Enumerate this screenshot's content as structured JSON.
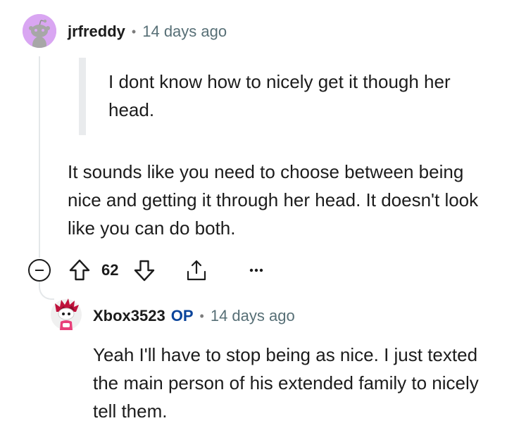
{
  "comment": {
    "author": "jrfreddy",
    "separator": "•",
    "time": "14 days ago",
    "quote": "I dont know how to nicely get it though her head.",
    "body": "It sounds like you need to choose between being nice and getting it through her head. It doesn't look like you can do both.",
    "vote_count": "62",
    "more_label": "•••"
  },
  "reply": {
    "author": "Xbox3523",
    "badge": "OP",
    "separator": "•",
    "time": "14 days ago",
    "body": "Yeah I'll have to stop being as nice. I just texted the main person of his extended family to nicely tell them."
  },
  "icons": {
    "avatar_1": "snoo-avatar-icon",
    "avatar_2": "custom-snoo-avatar-icon",
    "collapse": "collapse-thread-icon",
    "upvote": "upvote-arrow-icon",
    "downvote": "downvote-arrow-icon",
    "share": "share-icon",
    "more": "more-options-icon"
  },
  "colors": {
    "text": "#1c1c1c",
    "meta": "#576f76",
    "op_badge": "#0a449b",
    "avatar_bg": "#d9a6f2",
    "thread_line": "#e4e7e9"
  }
}
